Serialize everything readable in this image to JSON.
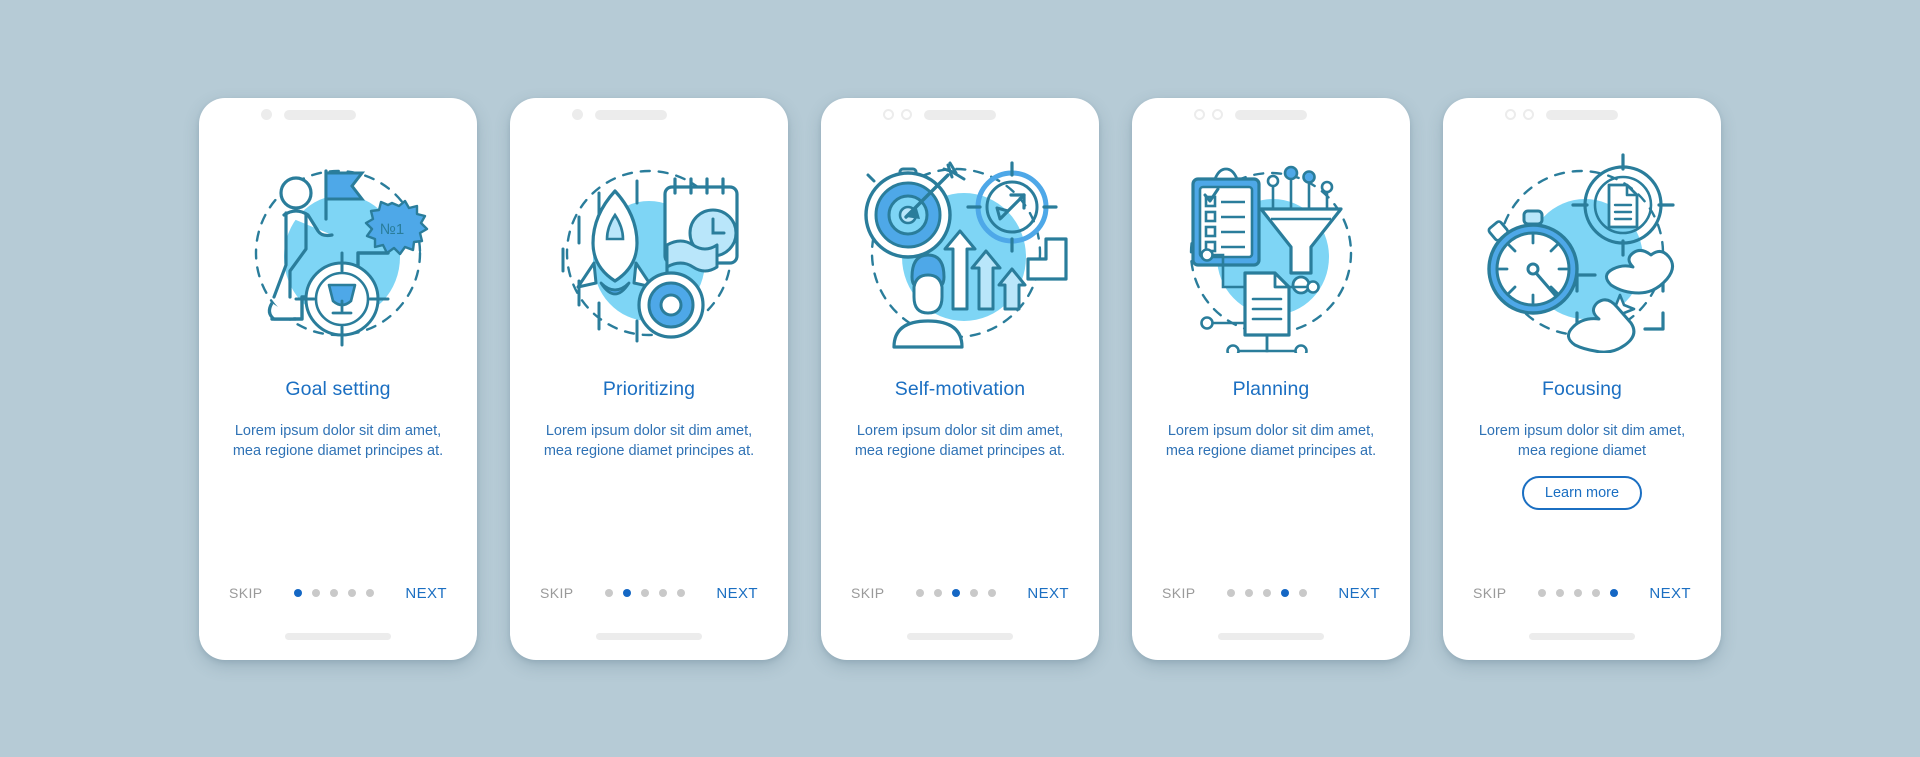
{
  "background_color": "#b6cbd6",
  "theme": {
    "title_color": "#1b6fc2",
    "body_color": "#2f72b5",
    "accent_color": "#1467c4",
    "skip_color": "#9a9a9a",
    "blob_color": "#7ed5f5",
    "line_color": "#2a7d9b",
    "fill_blue": "#4ea8e8",
    "card_bg": "#ffffff"
  },
  "screens": [
    {
      "id": "goal-setting",
      "status_icons": [
        "dot-filled",
        "pill"
      ],
      "illustration": "goal-setting-illustration",
      "badge_label": "№1",
      "title": "Goal setting",
      "description": "Lorem ipsum dolor sit dim amet, mea regione diamet principes at.",
      "has_learn_more": false,
      "learn_more_label": "",
      "skip_label": "SKIP",
      "next_label": "NEXT",
      "dot_count": 5,
      "active_dot": 0
    },
    {
      "id": "prioritizing",
      "status_icons": [
        "dot-filled",
        "pill"
      ],
      "illustration": "prioritizing-illustration",
      "badge_label": "",
      "title": "Prioritizing",
      "description": "Lorem ipsum dolor sit dim amet, mea regione diamet principes at.",
      "has_learn_more": false,
      "learn_more_label": "",
      "skip_label": "SKIP",
      "next_label": "NEXT",
      "dot_count": 5,
      "active_dot": 1
    },
    {
      "id": "self-motivation",
      "status_icons": [
        "dot-ring",
        "dot-ring",
        "pill"
      ],
      "illustration": "self-motivation-illustration",
      "badge_label": "",
      "title": "Self-motivation",
      "description": "Lorem ipsum dolor sit dim amet, mea regione diamet principes at.",
      "has_learn_more": false,
      "learn_more_label": "",
      "skip_label": "SKIP",
      "next_label": "NEXT",
      "dot_count": 5,
      "active_dot": 2
    },
    {
      "id": "planning",
      "status_icons": [
        "dot-ring",
        "dot-ring",
        "pill"
      ],
      "illustration": "planning-illustration",
      "badge_label": "",
      "title": "Planning",
      "description": "Lorem ipsum dolor sit dim amet, mea regione diamet principes at.",
      "has_learn_more": false,
      "learn_more_label": "",
      "skip_label": "SKIP",
      "next_label": "NEXT",
      "dot_count": 5,
      "active_dot": 3
    },
    {
      "id": "focusing",
      "status_icons": [
        "dot-ring",
        "dot-ring",
        "pill"
      ],
      "illustration": "focusing-illustration",
      "badge_label": "",
      "title": "Focusing",
      "description": "Lorem ipsum dolor sit dim amet, mea regione diamet",
      "has_learn_more": true,
      "learn_more_label": "Learn more",
      "skip_label": "SKIP",
      "next_label": "NEXT",
      "dot_count": 5,
      "active_dot": 4
    }
  ]
}
